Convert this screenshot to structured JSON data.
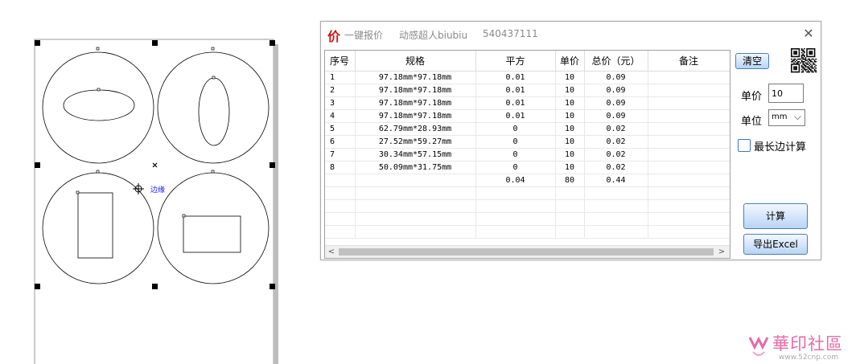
{
  "canvas": {
    "tooltip_label": "边缘"
  },
  "dialog": {
    "icon": "价",
    "app_title": "一键报价",
    "author": "动感超人biubiu",
    "qq": "540437111",
    "close_icon": "close-icon",
    "clear_label": "清空",
    "price_label": "单价",
    "price_value": "10",
    "unit_label": "单位",
    "unit_value": "mm",
    "longest_label": "最长边计算",
    "longest_checked": false,
    "calc_label": "计算",
    "export_label": "导出Excel"
  },
  "table": {
    "headers": [
      "序号",
      "规格",
      "平方",
      "单价",
      "总价（元）",
      "备注"
    ],
    "rows": [
      [
        "1",
        "97.18mm*97.18mm",
        "0.01",
        "10",
        "0.09",
        ""
      ],
      [
        "2",
        "97.18mm*97.18mm",
        "0.01",
        "10",
        "0.09",
        ""
      ],
      [
        "3",
        "97.18mm*97.18mm",
        "0.01",
        "10",
        "0.09",
        ""
      ],
      [
        "4",
        "97.18mm*97.18mm",
        "0.01",
        "10",
        "0.09",
        ""
      ],
      [
        "5",
        "62.79mm*28.93mm",
        "0",
        "10",
        "0.02",
        ""
      ],
      [
        "6",
        "27.52mm*59.27mm",
        "0",
        "10",
        "0.02",
        ""
      ],
      [
        "7",
        "30.34mm*57.15mm",
        "0",
        "10",
        "0.02",
        ""
      ],
      [
        "8",
        "50.09mm*31.75mm",
        "0",
        "10",
        "0.02",
        ""
      ],
      [
        "",
        "",
        "0.04",
        "80",
        "0.44",
        ""
      ],
      [
        "",
        "",
        "",
        "",
        "",
        ""
      ],
      [
        "",
        "",
        "",
        "",
        "",
        ""
      ],
      [
        "",
        "",
        "",
        "",
        "",
        ""
      ],
      [
        "",
        "",
        "",
        "",
        "",
        ""
      ]
    ]
  },
  "watermark": {
    "text": "華印社區",
    "url": "www.52cnp.com"
  }
}
